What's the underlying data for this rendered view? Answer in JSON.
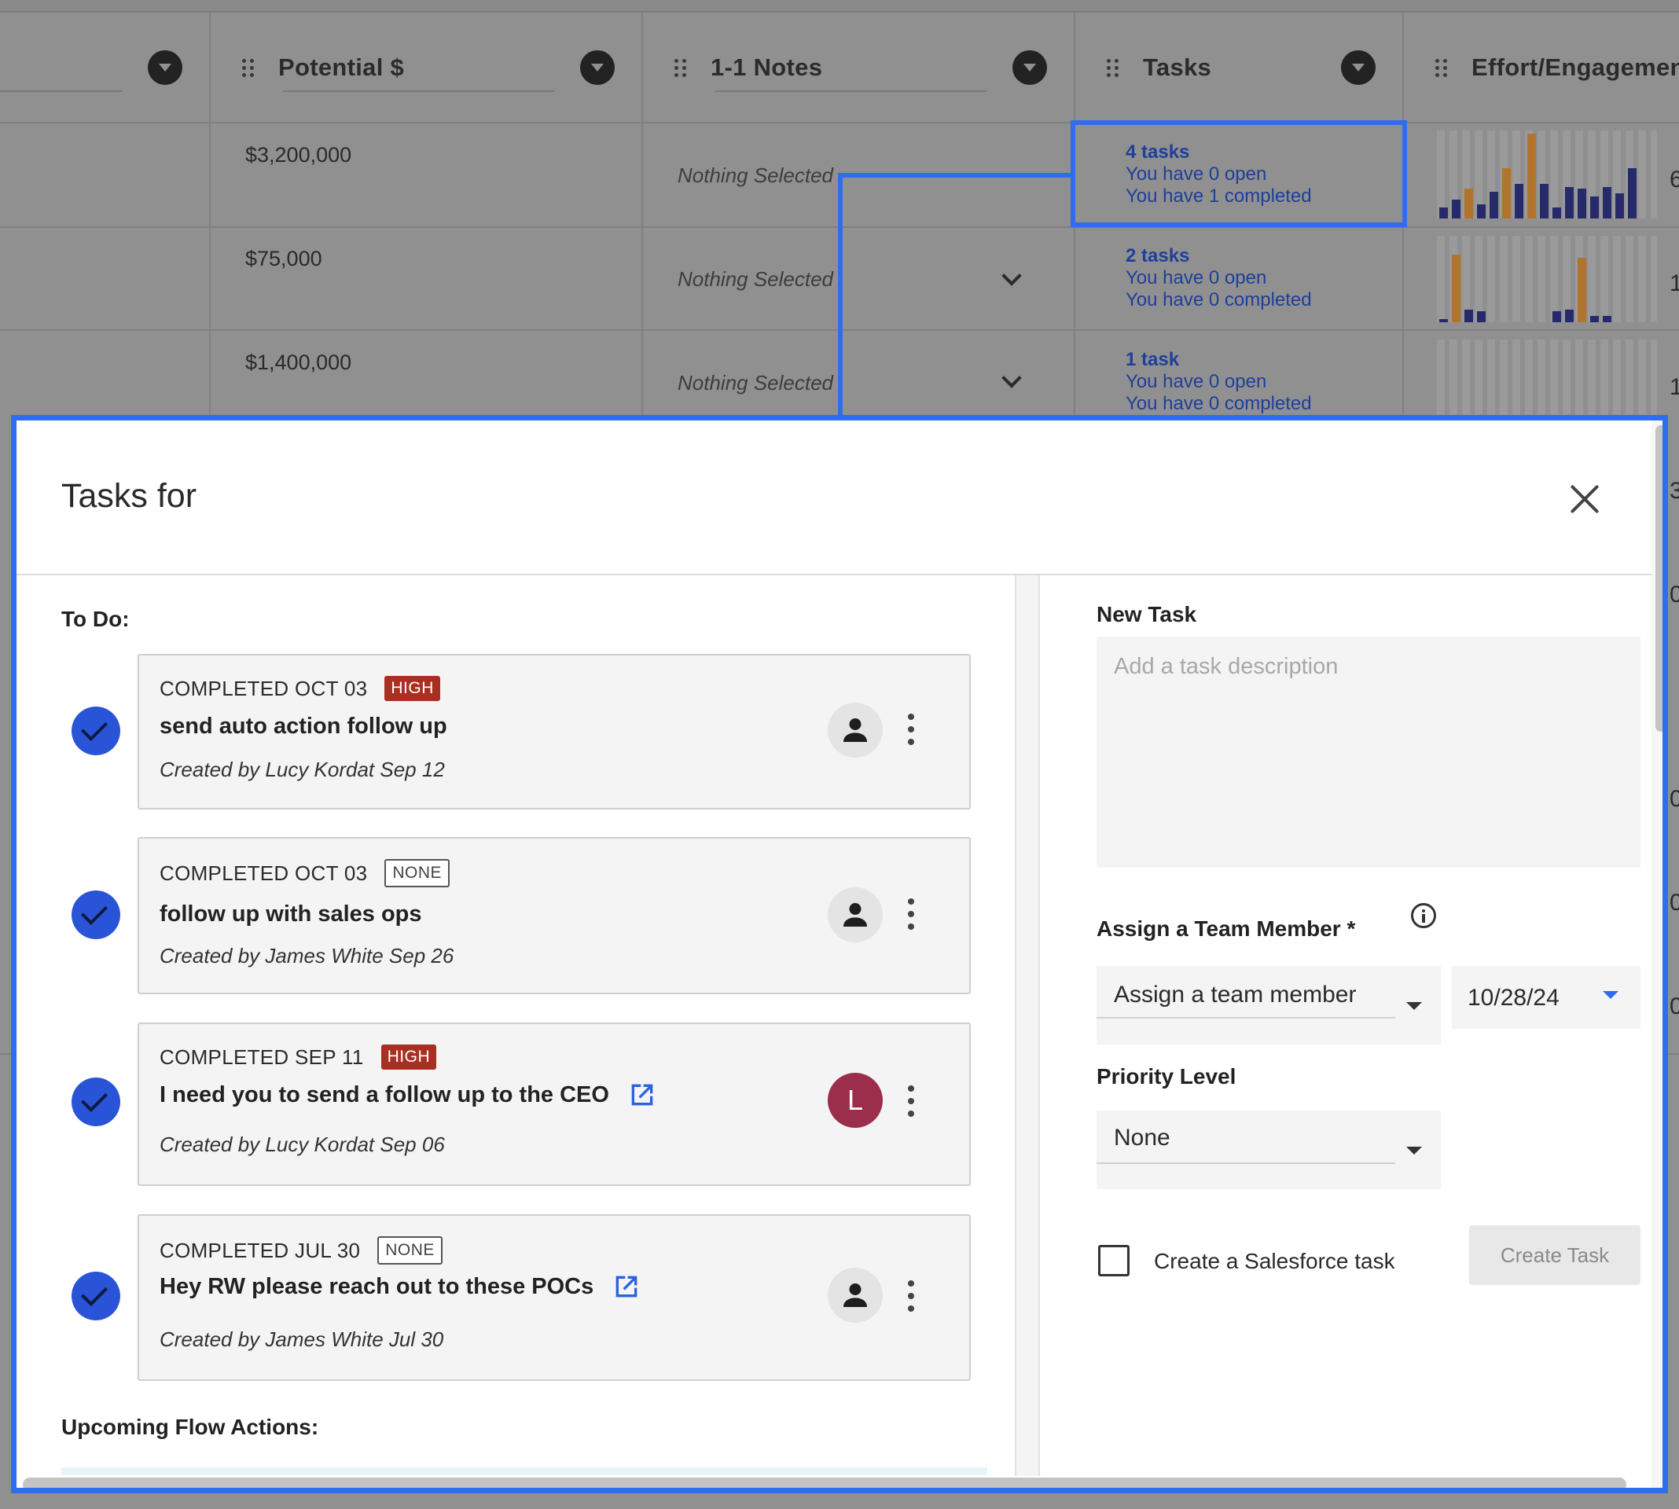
{
  "grid": {
    "columns": [
      {
        "label": "Potential $"
      },
      {
        "label": "1-1 Notes"
      },
      {
        "label": "Tasks"
      },
      {
        "label": "Effort/Engagement"
      }
    ],
    "rows": [
      {
        "potential": "$3,200,000",
        "notes": "Nothing Selected",
        "tasks_count": "4 tasks",
        "tasks_open": "You have 0 open",
        "tasks_completed": "You have 1 completed",
        "edge": "6"
      },
      {
        "potential": "$75,000",
        "notes": "Nothing Selected",
        "tasks_count": "2 tasks",
        "tasks_open": "You have 0 open",
        "tasks_completed": "You have 0 completed",
        "edge": "1"
      },
      {
        "potential": "$1,400,000",
        "notes": "Nothing Selected",
        "tasks_count": "1 task",
        "tasks_open": "You have 0 open",
        "tasks_completed": "You have 0 completed",
        "edge": "1"
      }
    ],
    "edge_digits_below": [
      "3",
      "0",
      "0",
      "0",
      "0"
    ]
  },
  "dialog": {
    "title": "Tasks for",
    "todo_label": "To Do:",
    "upcoming_label": "Upcoming Flow Actions:",
    "tasks": [
      {
        "status": "COMPLETED OCT 03",
        "priority": "HIGH",
        "title": "send auto action follow up",
        "meta": "Created by Lucy Kordat Sep 12",
        "external": false,
        "avatar": "person-icon"
      },
      {
        "status": "COMPLETED OCT 03",
        "priority": "NONE",
        "title": "follow up with sales ops",
        "meta": "Created by James White Sep 26",
        "external": false,
        "avatar": "person-icon"
      },
      {
        "status": "COMPLETED SEP 11",
        "priority": "HIGH",
        "title": "I need you to send a follow up to the CEO",
        "meta": "Created by Lucy Kordat Sep 06",
        "external": true,
        "avatar": "L"
      },
      {
        "status": "COMPLETED JUL 30",
        "priority": "NONE",
        "title": "Hey RW please reach out to these POCs",
        "meta": "Created by James White Jul 30",
        "external": true,
        "avatar": "person-icon"
      }
    ],
    "new_task": {
      "label": "New Task",
      "placeholder": "Add a task description",
      "assign_label": "Assign a Team Member *",
      "assign_value": "Assign a team member",
      "date_value": "10/28/24",
      "priority_label": "Priority Level",
      "priority_value": "None",
      "salesforce_label": "Create a Salesforce task",
      "create_button": "Create Task"
    }
  },
  "colors": {
    "accent": "#2f6df0",
    "check": "#2a54d7",
    "high_badge": "#a83023",
    "avatar_letter_bg": "#9b2e4a",
    "bar_orange": "#b0742c",
    "bar_navy": "#272a6a"
  }
}
